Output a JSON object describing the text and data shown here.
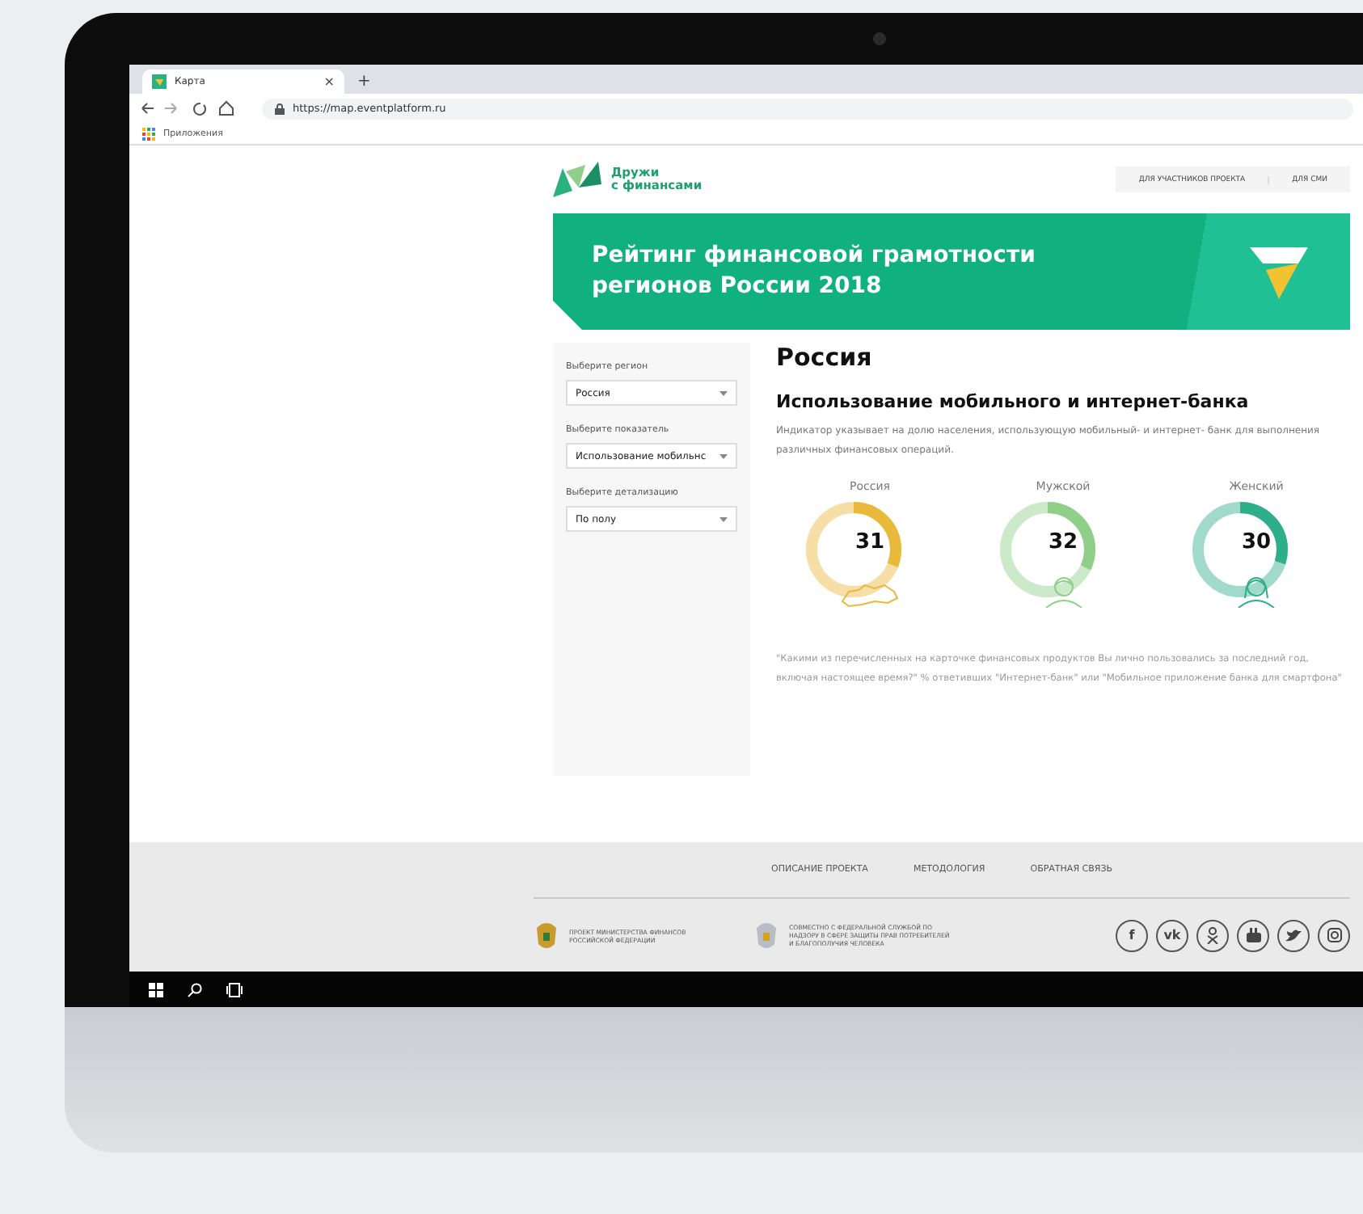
{
  "browser": {
    "tab_title": "Карта",
    "tab_close": "×",
    "new_tab": "+",
    "url": "https://map.eventplatform.ru",
    "bookmarks": "Приложения"
  },
  "header": {
    "logo_lines": [
      "Дружи",
      "с финансами"
    ],
    "nav": [
      "ДЛЯ УЧАСТНИКОВ ПРОЕКТА",
      "ДЛЯ СМИ"
    ]
  },
  "banner": {
    "title": "Рейтинг финансовой грамотности регионов России 2018"
  },
  "filters": [
    {
      "label": "Выберите регион",
      "value": "Россия"
    },
    {
      "label": "Выберите показатель",
      "value": "Использование мобильнс"
    },
    {
      "label": "Выберите детализацию",
      "value": "По полу"
    }
  ],
  "main": {
    "region": "Россия",
    "indicator": "Использование мобильного и интернет-банка",
    "description": "Индикатор указывает на долю населения, использующую мобильный- и интернет- банк для выполнения различных финансовых операций.",
    "gauges": [
      {
        "kind": "map",
        "label": "Россия",
        "value": "31",
        "level": 0.31,
        "color": "#e8b93a"
      },
      {
        "kind": "male",
        "label": "Мужской",
        "value": "32",
        "level": 0.32,
        "color": "#8fcf8a"
      },
      {
        "kind": "female",
        "label": "Женский",
        "value": "30",
        "level": 0.3,
        "color": "#2fae8a"
      }
    ],
    "footnote": "\"Какими из перечисленных на карточке финансовых продуктов Вы лично пользовались за последний год, включая настоящее время?\" % ответивших \"Интернет-банк\" или \"Мобильное приложение банка для смартфона\""
  },
  "footer": {
    "links": [
      "ОПИСАНИЕ ПРОЕКТА",
      "МЕТОДОЛОГИЯ",
      "ОБРАТНАЯ СВЯЗЬ"
    ],
    "orgs": [
      "ПРОЕКТ МИНИСТЕРСТВА ФИНАНСОВ РОССИЙСКОЙ ФЕДЕРАЦИИ",
      "СОВМЕСТНО С ФЕДЕРАЛЬНОЙ СЛУЖБОЙ ПО НАДЗОРУ В СФЕРЕ ЗАЩИТЫ ПРАВ ПОТРЕБИТЕЛЕЙ И БЛАГОПОЛУЧИЯ ЧЕЛОВЕКА"
    ],
    "social": [
      {
        "kind": "facebook",
        "glyph": "f"
      },
      {
        "kind": "vk",
        "glyph": "vk"
      },
      {
        "kind": "ok"
      },
      {
        "kind": "youtube"
      },
      {
        "kind": "twitter"
      },
      {
        "kind": "instagram"
      }
    ]
  }
}
